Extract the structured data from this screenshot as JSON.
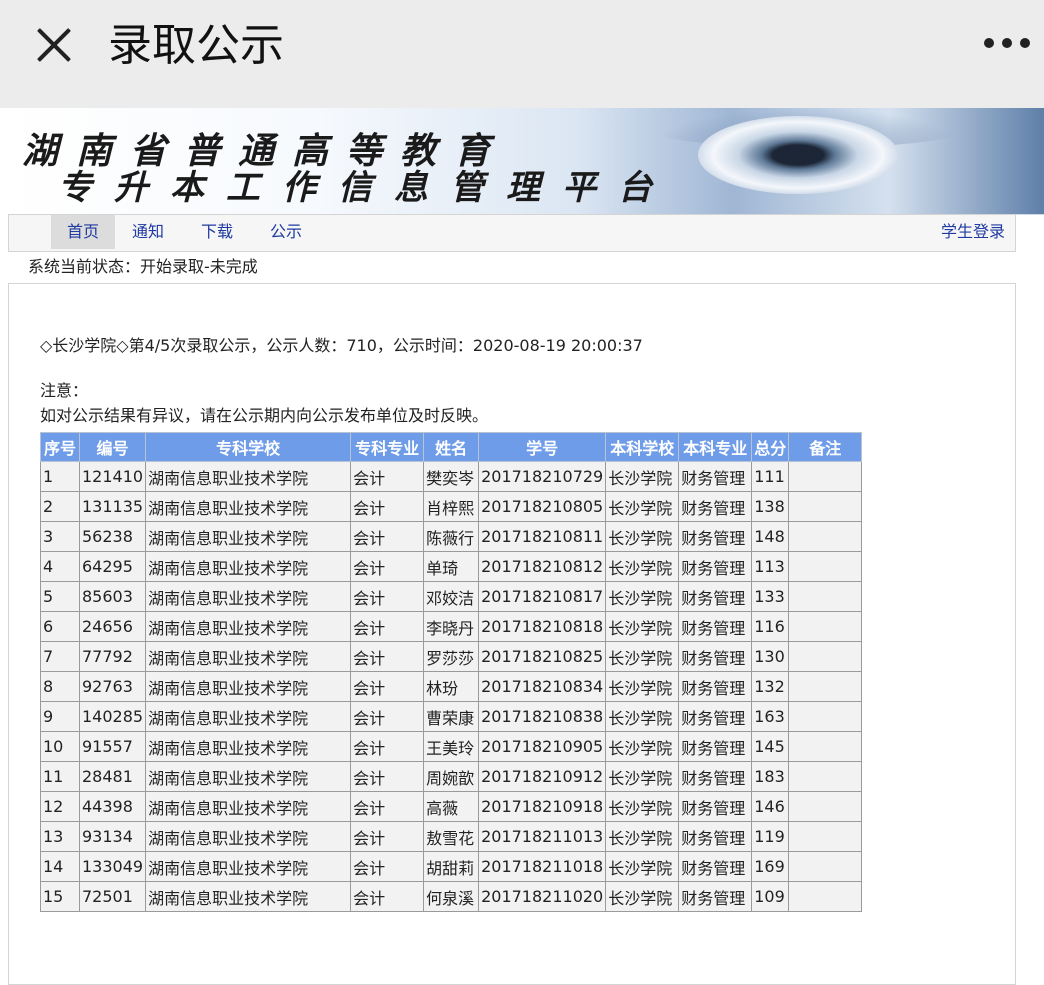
{
  "app_bar": {
    "title": "录取公示",
    "close_icon": "close-icon",
    "more_icon": "more-options-icon"
  },
  "banner": {
    "line1": "湖南省普通高等教育",
    "line2": "专升本工作信息管理平台"
  },
  "nav": {
    "items": [
      {
        "label": "首页",
        "active": true
      },
      {
        "label": "通知",
        "active": false
      },
      {
        "label": "下载",
        "active": false
      },
      {
        "label": "公示",
        "active": false
      }
    ],
    "login": "学生登录"
  },
  "system_status": "系统当前状态：开始录取-未完成",
  "announcement": "◇长沙学院◇第4/5次录取公示，公示人数：710，公示时间：2020-08-19 20:00:37",
  "notice": {
    "title": "注意：",
    "text": "如对公示结果有异议，请在公示期内向公示发布单位及时反映。"
  },
  "table": {
    "headers": [
      "序号",
      "编号",
      "专科学校",
      "专科专业",
      "姓名",
      "学号",
      "本科学校",
      "本科专业",
      "总分",
      "备注"
    ],
    "rows": [
      [
        "1",
        "121410",
        "湖南信息职业技术学院",
        "会计",
        "樊奕岑",
        "201718210729",
        "长沙学院",
        "财务管理",
        "111",
        ""
      ],
      [
        "2",
        "131135",
        "湖南信息职业技术学院",
        "会计",
        "肖梓熙",
        "201718210805",
        "长沙学院",
        "财务管理",
        "138",
        ""
      ],
      [
        "3",
        "56238",
        "湖南信息职业技术学院",
        "会计",
        "陈薇行",
        "201718210811",
        "长沙学院",
        "财务管理",
        "148",
        ""
      ],
      [
        "4",
        "64295",
        "湖南信息职业技术学院",
        "会计",
        "单琦",
        "201718210812",
        "长沙学院",
        "财务管理",
        "113",
        ""
      ],
      [
        "5",
        "85603",
        "湖南信息职业技术学院",
        "会计",
        "邓姣洁",
        "201718210817",
        "长沙学院",
        "财务管理",
        "133",
        ""
      ],
      [
        "6",
        "24656",
        "湖南信息职业技术学院",
        "会计",
        "李晓丹",
        "201718210818",
        "长沙学院",
        "财务管理",
        "116",
        ""
      ],
      [
        "7",
        "77792",
        "湖南信息职业技术学院",
        "会计",
        "罗莎莎",
        "201718210825",
        "长沙学院",
        "财务管理",
        "130",
        ""
      ],
      [
        "8",
        "92763",
        "湖南信息职业技术学院",
        "会计",
        "林玢",
        "201718210834",
        "长沙学院",
        "财务管理",
        "132",
        ""
      ],
      [
        "9",
        "140285",
        "湖南信息职业技术学院",
        "会计",
        "曹荣康",
        "201718210838",
        "长沙学院",
        "财务管理",
        "163",
        ""
      ],
      [
        "10",
        "91557",
        "湖南信息职业技术学院",
        "会计",
        "王美玲",
        "201718210905",
        "长沙学院",
        "财务管理",
        "145",
        ""
      ],
      [
        "11",
        "28481",
        "湖南信息职业技术学院",
        "会计",
        "周婉歆",
        "201718210912",
        "长沙学院",
        "财务管理",
        "183",
        ""
      ],
      [
        "12",
        "44398",
        "湖南信息职业技术学院",
        "会计",
        "高薇",
        "201718210918",
        "长沙学院",
        "财务管理",
        "146",
        ""
      ],
      [
        "13",
        "93134",
        "湖南信息职业技术学院",
        "会计",
        "敖雪花",
        "201718211013",
        "长沙学院",
        "财务管理",
        "119",
        ""
      ],
      [
        "14",
        "133049",
        "湖南信息职业技术学院",
        "会计",
        "胡甜莉",
        "201718211018",
        "长沙学院",
        "财务管理",
        "169",
        ""
      ],
      [
        "15",
        "72501",
        "湖南信息职业技术学院",
        "会计",
        "何泉溪",
        "201718211020",
        "长沙学院",
        "财务管理",
        "109",
        ""
      ]
    ]
  }
}
